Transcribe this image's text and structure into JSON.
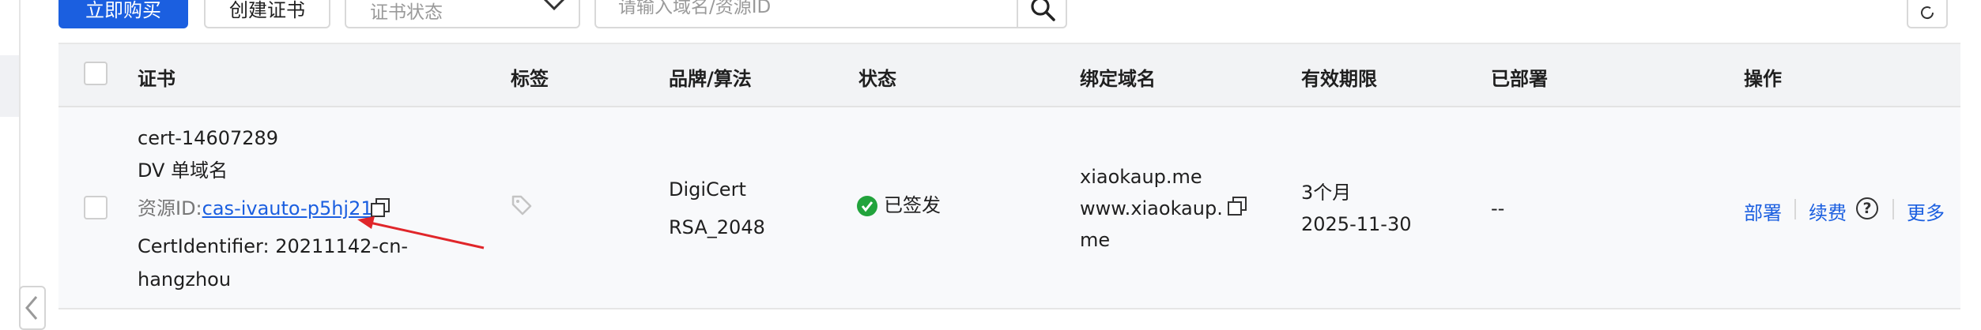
{
  "toolbar": {
    "buy_label": "立即购买",
    "create_label": "创建证书",
    "status_placeholder": "证书状态",
    "search_placeholder": "请输入域名/资源ID"
  },
  "table": {
    "columns": [
      "证书",
      "标签",
      "品牌/算法",
      "状态",
      "绑定域名",
      "有效期限",
      "已部署",
      "操作"
    ],
    "row": {
      "cert_name": "cert-14607289",
      "cert_type": "DV 单域名",
      "resource_label": "资源ID:",
      "resource_id": "cas-ivauto-p5hj21",
      "identifier_line1": "CertIdentifier: 20211142-cn-",
      "identifier_line2": "hangzhou",
      "brand": "DigiCert",
      "algorithm": "RSA_2048",
      "status": "已签发",
      "domain_line1": "xiaokaup.me",
      "domain_line2": "www.xiaokaup.",
      "domain_line3": "me",
      "validity_period": "3个月",
      "validity_date": "2025-11-30",
      "deployed": "--",
      "actions": {
        "deploy": "部署",
        "renew": "续费",
        "help": "?",
        "more": "更多"
      }
    }
  },
  "colors": {
    "primary": "#1b5fe0",
    "success": "#22a33c",
    "arrow": "#e0262a"
  }
}
